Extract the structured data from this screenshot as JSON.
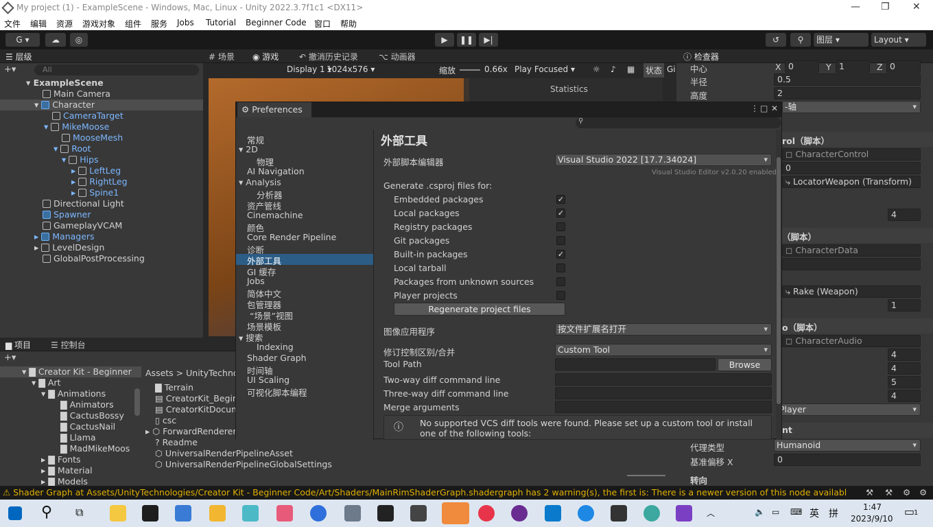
{
  "window": {
    "title": "My project (1) - ExampleScene - Windows, Mac, Linux - Unity 2022.3.7f1c1 <DX11>"
  },
  "menu": [
    "文件",
    "编辑",
    "资源",
    "游戏对象",
    "组件",
    "服务",
    "Jobs",
    "Tutorial",
    "Beginner Code",
    "窗口",
    "帮助"
  ],
  "toolbar": {
    "account": "G ▾",
    "layers": "图层",
    "layout": "Layout"
  },
  "hierarchy": {
    "tab": "层级",
    "search_placeholder": "All",
    "items": [
      "ExampleScene",
      "Main Camera",
      "Character",
      "CameraTarget",
      "MikeMoose",
      "MooseMesh",
      "Root",
      "Hips",
      "LeftLeg",
      "RightLeg",
      "Spine1",
      "Directional Light",
      "Spawner",
      "GameplayVCAM",
      "Managers",
      "LevelDesign",
      "GlobalPostProcessing"
    ]
  },
  "game": {
    "tabs": [
      "场景",
      "游戏",
      "撤消历史记录",
      "动画器"
    ],
    "display": "Display 1",
    "resolution": "1024x576",
    "scale_label": "缩放",
    "scale": "0.66x",
    "play_mode": "Play Focused",
    "stats": "状态",
    "gizmos": "Gi",
    "statistics": "Statistics"
  },
  "inspector": {
    "tab": "检查器",
    "center": "中心",
    "x": "X",
    "x_val": "0",
    "y": "Y",
    "y_val": "1",
    "z": "Z",
    "z_val": "0",
    "radius_label": "半径",
    "radius": "0.5",
    "height_label": "高度",
    "height": "2",
    "axis": "-轴",
    "script1": "rol（脚本）",
    "ref1": "CharacterControl",
    "val1": "0",
    "ref2": "LocatorWeapon (Transform)",
    "num1": "4",
    "script2": "（脚本）",
    "ref3": "CharacterData",
    "ref4": "Rake (Weapon)",
    "num2": "1",
    "script3": "o（脚本）",
    "ref5": "CharacterAudio",
    "n1": "4",
    "n2": "4",
    "n3": "5",
    "n4": "4",
    "player": "Player",
    "section": "nt",
    "avatar_label": "代理类型",
    "avatar": "Humanoid",
    "offset_label": "基准偏移 X",
    "offset": "0",
    "turn": "转向"
  },
  "project": {
    "tabs": [
      "项目",
      "控制台"
    ],
    "tree": [
      "Creator Kit - Beginner",
      "Art",
      "Animations",
      "Animators",
      "CactusBossy",
      "CactusNail",
      "Llama",
      "MadMikeMoos",
      "Fonts",
      "Material",
      "Models"
    ],
    "breadcrumb": [
      "Assets",
      ">",
      "UnityTechnolo"
    ],
    "files": [
      "Terrain",
      "CreatorKit_Beginn",
      "CreatorKitDocum",
      "csc",
      "ForwardRenderer",
      "Readme",
      "UniversalRenderPipelineAsset",
      "UniversalRenderPipelineGlobalSettings"
    ]
  },
  "prefs": {
    "title": "Preferences",
    "nav": [
      "常规",
      "2D",
      "物理",
      "AI Navigation",
      "Analysis",
      "分析器",
      "资产管线",
      "Cinemachine",
      "颜色",
      "Core Render Pipeline",
      "诊断",
      "外部工具",
      "GI 缓存",
      "Jobs",
      "简体中文",
      "包管理器",
      "“场景”视图",
      "场景模板",
      "搜索",
      "Indexing",
      "Shader Graph",
      "时间轴",
      "UI Scaling",
      "可视化脚本编程"
    ],
    "heading": "外部工具",
    "ext_editor_label": "外部脚本编辑器",
    "ext_editor": "Visual Studio 2022 [17.7.34024]",
    "ext_editor_note": "Visual Studio Editor v2.0.20 enabled",
    "gen_label": "Generate .csproj files for:",
    "packages": [
      {
        "label": "Embedded packages",
        "checked": "✓"
      },
      {
        "label": "Local packages",
        "checked": "✓"
      },
      {
        "label": "Registry packages",
        "checked": ""
      },
      {
        "label": "Git packages",
        "checked": ""
      },
      {
        "label": "Built-in packages",
        "checked": "✓"
      },
      {
        "label": "Local tarball",
        "checked": ""
      },
      {
        "label": "Packages from unknown sources",
        "checked": ""
      },
      {
        "label": "Player projects",
        "checked": ""
      }
    ],
    "regen": "Regenerate project files",
    "image_app_label": "图像应用程序",
    "image_app": "按文件扩展名打开",
    "revision_label": "修订控制区别/合并",
    "revision": "Custom Tool",
    "tool_path_label": "Tool Path",
    "browse": "Browse",
    "twoway": "Two-way diff command line",
    "threeway": "Three-way diff command line",
    "merge": "Merge arguments",
    "vcs_msg": "No supported VCS diff tools were found. Please set up a custom tool or install one of the following tools:"
  },
  "status": "⚠ Shader Graph at Assets/UnityTechnologies/Creator Kit - Beginner Code/Art/Shaders/MainRimShaderGraph.shadergraph has 2 warning(s), the first is: There is a newer version of this node available. Inspect noc",
  "taskbar": {
    "ime1": "英",
    "ime2": "拼",
    "time": "1:47",
    "date": "2023/9/10",
    "notif": "1"
  }
}
